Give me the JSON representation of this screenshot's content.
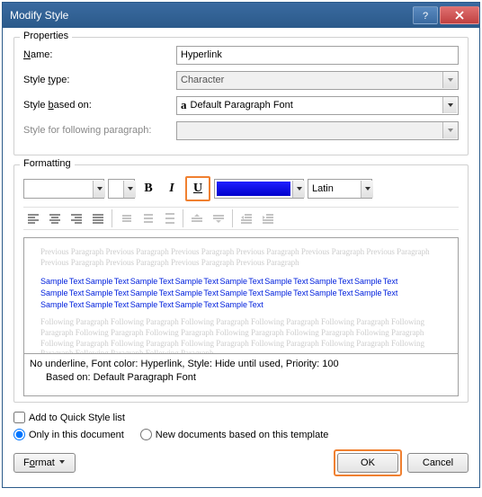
{
  "title": "Modify Style",
  "properties": {
    "legend": "Properties",
    "name_label": "Name:",
    "name_value": "Hyperlink",
    "style_type_label": "Style type:",
    "style_type_value": "Character",
    "based_on_label": "Style based on:",
    "based_on_value": "Default Paragraph Font",
    "following_label": "Style for following paragraph:",
    "following_value": ""
  },
  "formatting": {
    "legend": "Formatting",
    "bold": "B",
    "italic": "I",
    "underline": "U",
    "script_value": "Latin",
    "preview_prev": "Previous Paragraph Previous Paragraph Previous Paragraph Previous Paragraph Previous Paragraph Previous Paragraph Previous Paragraph Previous Paragraph Previous Paragraph Previous Paragraph",
    "sample1": "Sample Text Sample Text Sample Text Sample Text Sample Text Sample Text Sample Text Sample Text",
    "sample2": "Sample Text Sample Text Sample Text Sample Text Sample Text Sample Text Sample Text Sample Text",
    "sample3": "Sample Text Sample Text Sample Text Sample Text Sample Text",
    "preview_next": "Following Paragraph Following Paragraph Following Paragraph Following Paragraph Following Paragraph Following Paragraph Following Paragraph Following Paragraph Following Paragraph Following Paragraph Following Paragraph Following Paragraph Following Paragraph Following Paragraph Following Paragraph Following Paragraph Following Paragraph Following Paragraph Following Paragraph",
    "description_line1": "No underline, Font color: Hyperlink, Style: Hide until used, Priority: 100",
    "description_line2": "Based on: Default Paragraph Font"
  },
  "options": {
    "quick_style": "Add to Quick Style list",
    "only_doc": "Only in this document",
    "new_docs": "New documents based on this template"
  },
  "buttons": {
    "format": "Format",
    "ok": "OK",
    "cancel": "Cancel"
  },
  "icons": {
    "font_glyph": "a"
  }
}
